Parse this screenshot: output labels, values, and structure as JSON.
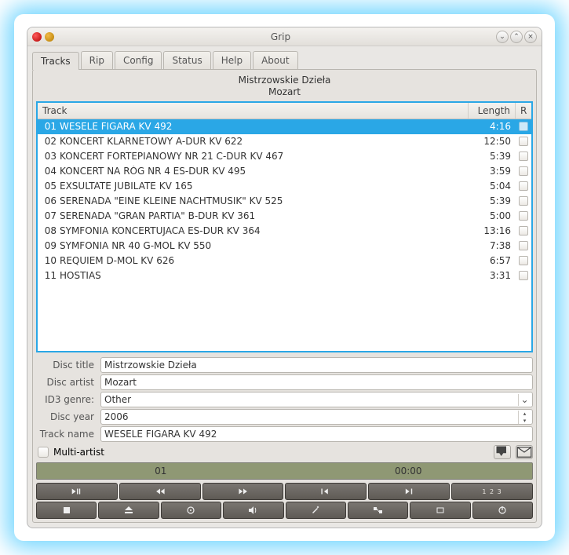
{
  "window": {
    "title": "Grip"
  },
  "tabs": {
    "tracks": "Tracks",
    "rip": "Rip",
    "config": "Config",
    "status": "Status",
    "help": "Help",
    "about": "About"
  },
  "album": {
    "title": "Mistrzowskie Dzieła",
    "artist": "Mozart"
  },
  "columns": {
    "track": "Track",
    "length": "Length",
    "r": "R"
  },
  "tracks": [
    {
      "num": "01",
      "name": "WESELE FIGARA KV 492",
      "length": "4:16",
      "selected": true
    },
    {
      "num": "02",
      "name": "KONCERT KLARNETOWY A-DUR KV 622",
      "length": "12:50"
    },
    {
      "num": "03",
      "name": "KONCERT FORTEPIANOWY NR 21 C-DUR KV 467",
      "length": "5:39"
    },
    {
      "num": "04",
      "name": "KONCERT NA RÓG NR 4 ES-DUR KV 495",
      "length": "3:59"
    },
    {
      "num": "05",
      "name": "EXSULTATE JUBILATE KV 165",
      "length": "5:04"
    },
    {
      "num": "06",
      "name": "SERENADA \"EINE KLEINE NACHTMUSIK\" KV 525",
      "length": "5:39"
    },
    {
      "num": "07",
      "name": "SERENADA \"GRAN PARTIA\" B-DUR KV 361",
      "length": "5:00"
    },
    {
      "num": "08",
      "name": "SYMFONIA KONCERTUJACA ES-DUR KV 364",
      "length": "13:16"
    },
    {
      "num": "09",
      "name": "SYMFONIA NR 40 G-MOL KV 550",
      "length": "7:38"
    },
    {
      "num": "10",
      "name": "REQUIEM D-MOL KV 626",
      "length": "6:57"
    },
    {
      "num": "11",
      "name": "HOSTIAS",
      "length": "3:31"
    }
  ],
  "form": {
    "disc_title_label": "Disc title",
    "disc_title": "Mistrzowskie Dzieła",
    "disc_artist_label": "Disc artist",
    "disc_artist": "Mozart",
    "genre_label": "ID3 genre:",
    "genre": "Other",
    "year_label": "Disc year",
    "year": "2006",
    "track_name_label": "Track name",
    "track_name": "WESELE FIGARA KV 492",
    "multi_artist_label": "Multi-artist"
  },
  "playback": {
    "track": "01",
    "time": "00:00"
  }
}
